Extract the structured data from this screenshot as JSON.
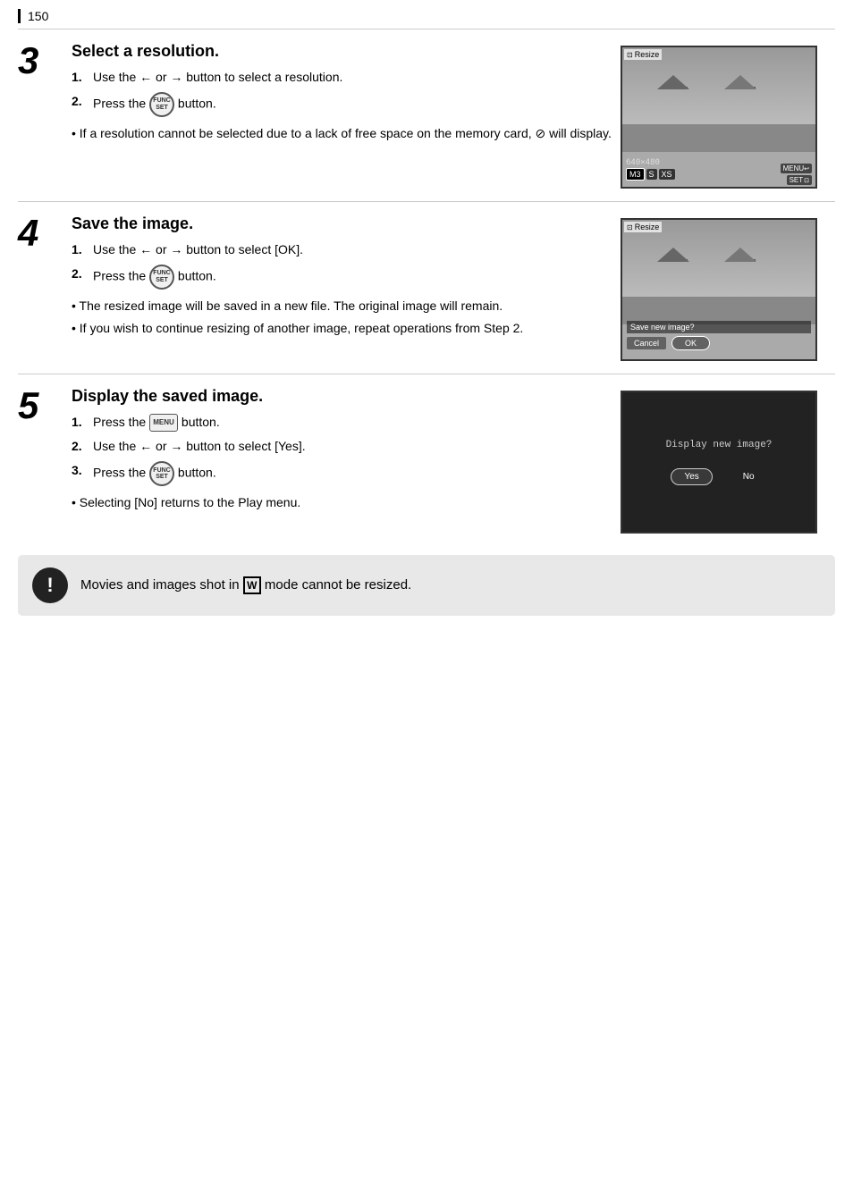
{
  "page": {
    "number": "150",
    "steps": [
      {
        "number": "3",
        "title": "Select a resolution.",
        "instructions": [
          {
            "num": "1.",
            "text_before": "Use the ",
            "arrow_left": "←",
            "or": "or",
            "arrow_right": "→",
            "text_after": " button to select a resolution."
          },
          {
            "num": "2.",
            "text_before": "Press the ",
            "button": "FUNC SET",
            "text_after": " button."
          }
        ],
        "notes": [
          "• If a resolution cannot be selected due to a lack of free space on the memory card,  will display."
        ],
        "screen": {
          "type": "resize-resolution",
          "label": "Resize",
          "resolution_text": "640×480",
          "options": [
            "M3",
            "S",
            "XS"
          ],
          "active_option": "M3",
          "menu_btn": "MENU",
          "set_btn": "SET"
        }
      },
      {
        "number": "4",
        "title": "Save the image.",
        "instructions": [
          {
            "num": "1.",
            "text_before": "Use the ",
            "arrow_left": "←",
            "or": "or",
            "arrow_right": "→",
            "text_after": " button to select [OK]."
          },
          {
            "num": "2.",
            "text_before": "Press the ",
            "button": "FUNC SET",
            "text_after": " button."
          }
        ],
        "notes": [
          "• The resized image will be saved in a new file. The original image will remain.",
          "• If you wish to continue resizing of another image, repeat operations from Step 2."
        ],
        "screen": {
          "type": "save-dialog",
          "label": "Resize",
          "dialog_text": "Save new image?",
          "cancel_label": "Cancel",
          "ok_label": "OK"
        }
      },
      {
        "number": "5",
        "title": "Display the saved image.",
        "instructions": [
          {
            "num": "1.",
            "text_before": "Press the ",
            "button": "MENU",
            "text_after": " button."
          },
          {
            "num": "2.",
            "text_before": "Use the ",
            "arrow_left": "←",
            "or": "or",
            "arrow_right": "→",
            "text_after": " button to select [Yes]."
          },
          {
            "num": "3.",
            "text_before": "Press the ",
            "button": "FUNC SET",
            "text_after": " button."
          }
        ],
        "notes": [
          "• Selecting [No] returns to the Play menu."
        ],
        "screen": {
          "type": "display-dialog",
          "question": "Display new image?",
          "yes_label": "Yes",
          "no_label": "No"
        }
      }
    ],
    "warning": {
      "text_before": "Movies and images shot in ",
      "mode": "W",
      "text_after": " mode cannot be resized."
    }
  }
}
